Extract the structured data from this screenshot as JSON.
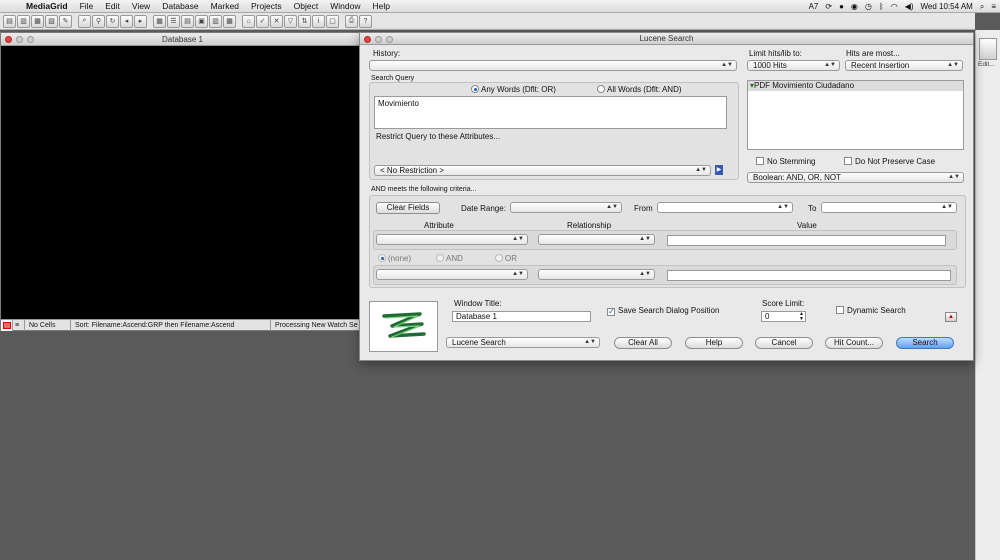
{
  "menubar": {
    "app": "MediaGrid",
    "items": [
      "File",
      "Edit",
      "View",
      "Database",
      "Marked",
      "Projects",
      "Object",
      "Window",
      "Help"
    ],
    "status_adobe": "7",
    "clock": "Wed 10:54 AM"
  },
  "dock": {
    "label": "Edit..."
  },
  "database_window": {
    "title": "Database 1",
    "status": {
      "cells": "No Cells",
      "sort": "Sort: Filename:Ascend:GRP then Filename:Ascend",
      "processing": "Processing New Watch Se"
    }
  },
  "dialog": {
    "title": "Lucene Search",
    "history_label": "History:",
    "history_value": "",
    "limit_label": "Limit hits/lib to:",
    "limit_value": "1000 Hits",
    "hits_label": "Hits are most...",
    "hits_value": "Recent Insertion",
    "search_query_label": "Search Query",
    "any_words": "Any Words (Dflt: OR)",
    "all_words": "All Words (Dflt: AND)",
    "query_text": "Movimiento",
    "restrict_label": "Restrict Query to these Attributes...",
    "restriction_value": "< No Restriction >",
    "library_item": "PDF Movimiento Ciudadano",
    "no_stemming": "No Stemming",
    "no_preserve_case": "Do Not Preserve Case",
    "boolean_value": "Boolean: AND, OR, NOT",
    "and_criteria_label": "AND meets the following criteria...",
    "clear_fields": "Clear Fields",
    "date_range_label": "Date Range:",
    "from_label": "From",
    "to_label": "To",
    "attribute_header": "Attribute",
    "relationship_header": "Relationship",
    "value_header": "Value",
    "radio_none": "(none)",
    "radio_and": "AND",
    "radio_or": "OR",
    "window_title_label": "Window Title:",
    "window_title_value": "Database 1",
    "save_position": "Save Search Dialog Position",
    "score_limit_label": "Score Limit:",
    "score_limit_value": "0",
    "dynamic_search": "Dynamic Search",
    "mode_value": "Lucene Search",
    "btn_clear_all": "Clear All",
    "btn_help": "Help",
    "btn_cancel": "Cancel",
    "btn_hit_count": "Hit Count...",
    "btn_search": "Search"
  }
}
